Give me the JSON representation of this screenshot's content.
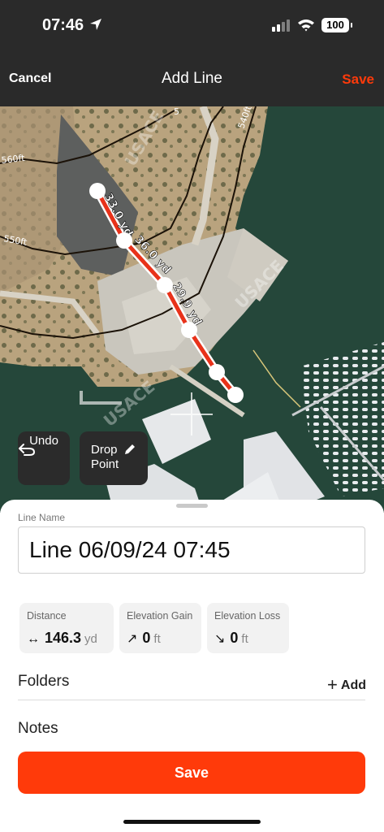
{
  "status_bar": {
    "time": "07:46",
    "battery": "100"
  },
  "nav": {
    "cancel_label": "Cancel",
    "title": "Add Line",
    "save_label": "Save"
  },
  "map": {
    "contour_labels": [
      "560ft",
      "550ft",
      "540ft",
      "5"
    ],
    "watermark_labels": [
      "USACE",
      "USACE",
      "USACE"
    ],
    "segment_labels": [
      "33.0 yd",
      "36.0 yd",
      "29.9 yd"
    ],
    "undo_label": "Undo",
    "drop_point_label": "Drop Point"
  },
  "sheet": {
    "line_name_label": "Line Name",
    "line_name_value": "Line 06/09/24 07:45",
    "stats": [
      {
        "title": "Distance",
        "symbol": "↔",
        "value": "146.3",
        "unit": "yd"
      },
      {
        "title": "Elevation Gain",
        "symbol": "↗",
        "value": "0",
        "unit": "ft"
      },
      {
        "title": "Elevation Loss",
        "symbol": "↘",
        "value": "0",
        "unit": "ft"
      }
    ],
    "folders_label": "Folders",
    "add_label": "Add",
    "notes_label": "Notes",
    "save_button_label": "Save"
  },
  "colors": {
    "accent": "#ff3a0a",
    "route": "#e8321a",
    "water": "#25473a",
    "land": "#b9a37e"
  }
}
